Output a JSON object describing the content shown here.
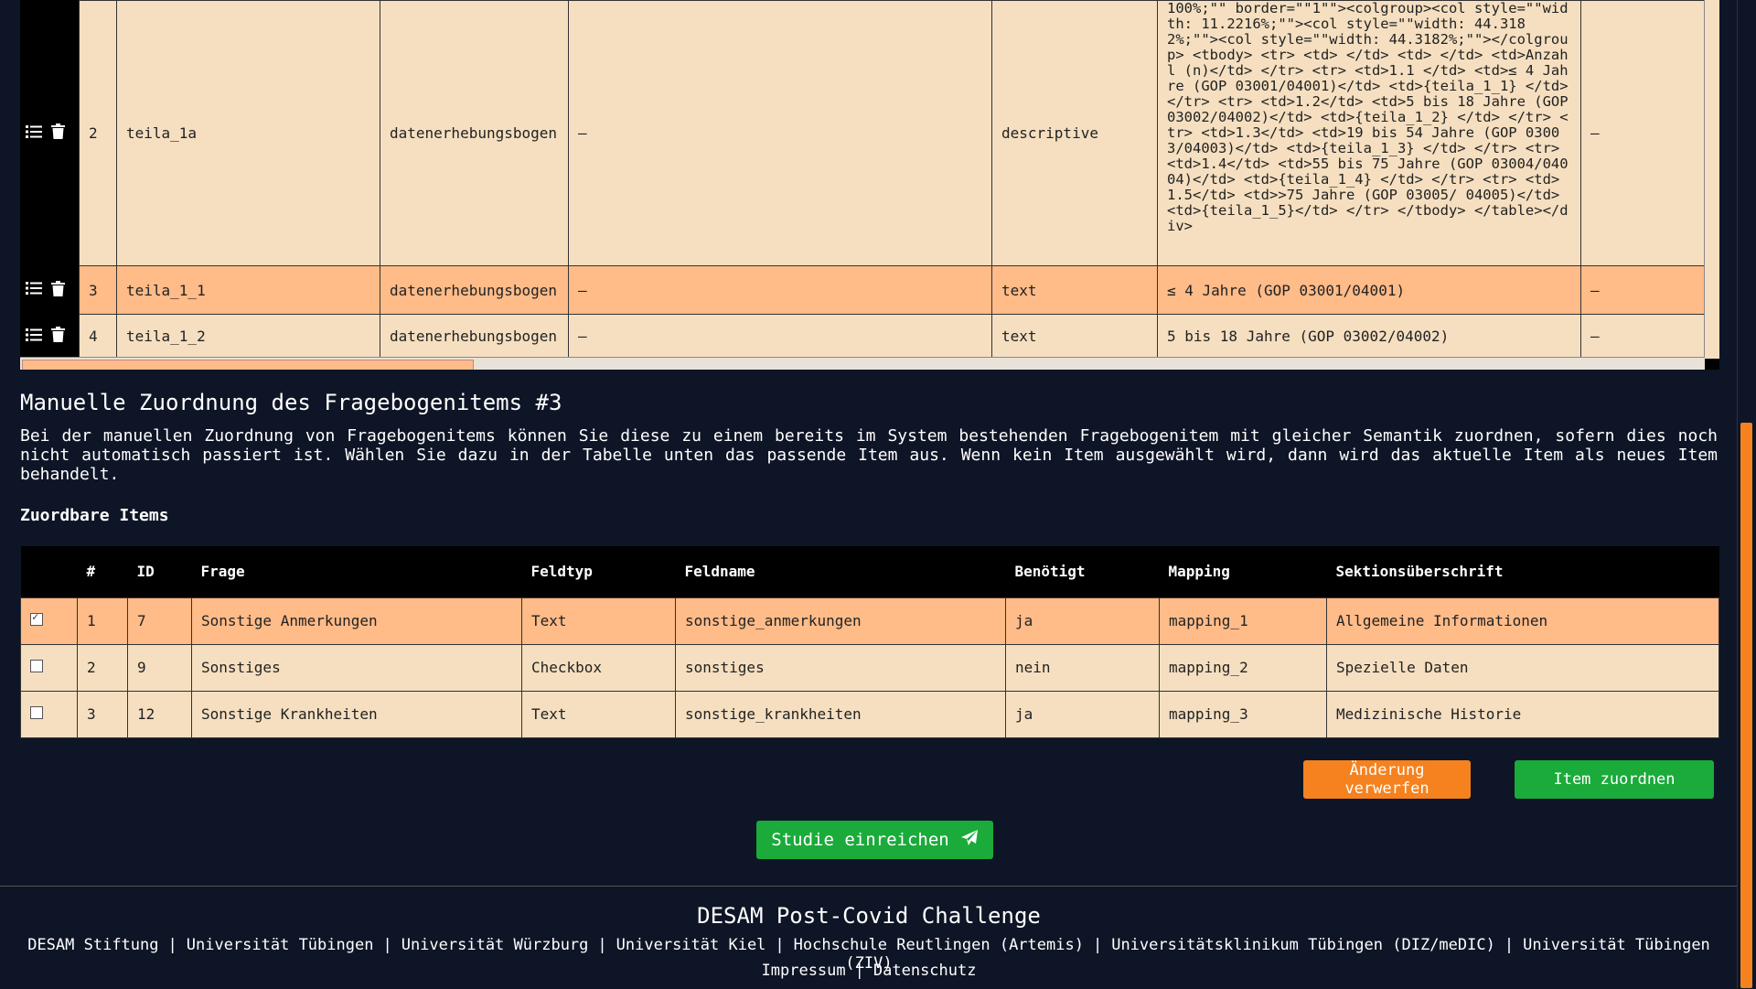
{
  "top_table": {
    "rows": [
      {
        "num": "2",
        "id": "teila_1a",
        "form": "datenerhebungsbogen",
        "dash1": "–",
        "type": "descriptive",
        "content": "100%;\"\" border=\"\"1\"\"><colgroup><col style=\"\"width: 11.2216%;\"\"><col style=\"\"width: 44.3182%;\"\"><col style=\"\"width: 44.3182%;\"\"></colgroup> <tbody> <tr> <td> </td> <td> </td> <td>Anzahl (n)</td> </tr> <tr> <td>1.1 </td> <td>≤ 4 Jahre (GOP 03001/04001)</td> <td>{teila_1_1} </td> </tr> <tr> <td>1.2</td> <td>5 bis 18 Jahre (GOP 03002/04002)</td> <td>{teila_1_2} </td> </tr> <tr> <td>1.3</td> <td>19 bis 54 Jahre (GOP 03003/04003)</td> <td>{teila_1_3} </td> </tr> <tr> <td>1.4</td> <td>55 bis 75 Jahre (GOP 03004/04004)</td> <td>{teila_1_4} </td> </tr> <tr> <td>1.5</td> <td>>75 Jahre (GOP 03005/ 04005)</td> <td>{teila_1_5}</td> </tr> </tbody> </table></div>",
        "dash2": "–"
      },
      {
        "num": "3",
        "id": "teila_1_1",
        "form": "datenerhebungsbogen",
        "dash1": "–",
        "type": "text",
        "content": "≤ 4 Jahre (GOP 03001/04001)",
        "dash2": "–"
      },
      {
        "num": "4",
        "id": "teila_1_2",
        "form": "datenerhebungsbogen",
        "dash1": "–",
        "type": "text",
        "content": "5 bis 18 Jahre (GOP 03002/04002)",
        "dash2": "–"
      }
    ]
  },
  "section": {
    "title": "Manuelle Zuordnung des Fragebogenitems #3",
    "description": "Bei der manuellen Zuordnung von Fragebogenitems können Sie diese zu einem bereits im System bestehenden Fragebogenitem mit gleicher Semantik zuordnen, sofern dies noch nicht automatisch passiert ist. Wählen Sie dazu in der Tabelle unten das passende Item aus. Wenn kein Item ausgewählt wird, dann wird das aktuelle Item als neues Item behandelt.",
    "subtitle": "Zuordbare Items"
  },
  "items_table": {
    "headers": [
      "#",
      "ID",
      "Frage",
      "Feldtyp",
      "Feldname",
      "Benötigt",
      "Mapping",
      "Sektionsüberschrift"
    ],
    "rows": [
      {
        "checked": true,
        "num": "1",
        "id": "7",
        "frage": "Sonstige Anmerkungen",
        "feldtyp": "Text",
        "feldname": "sonstige_anmerkungen",
        "benoetigt": "ja",
        "mapping": "mapping_1",
        "sektion": "Allgemeine Informationen"
      },
      {
        "checked": false,
        "num": "2",
        "id": "9",
        "frage": "Sonstiges",
        "feldtyp": "Checkbox",
        "feldname": "sonstiges",
        "benoetigt": "nein",
        "mapping": "mapping_2",
        "sektion": "Spezielle Daten"
      },
      {
        "checked": false,
        "num": "3",
        "id": "12",
        "frage": "Sonstige Krankheiten",
        "feldtyp": "Text",
        "feldname": "sonstige_krankheiten",
        "benoetigt": "ja",
        "mapping": "mapping_3",
        "sektion": "Medizinische Historie"
      }
    ]
  },
  "buttons": {
    "discard": "Änderung verwerfen",
    "assign": "Item zuordnen",
    "submit": "Studie einreichen"
  },
  "footer": {
    "title": "DESAM Post-Covid Challenge",
    "links": [
      "DESAM Stiftung",
      "Universität Tübingen",
      "Universität Würzburg",
      "Universität Kiel",
      "Hochschule Reutlingen (Artemis)",
      "Universitätsklinikum Tübingen (DIZ/meDIC)",
      "Universität Tübingen (ZIV)"
    ],
    "links2": [
      "Impressum",
      "Datenschutz"
    ]
  },
  "colors": {
    "accent_orange": "#f5821f",
    "accent_green": "#1aab3a",
    "row_light": "#f5dfc0",
    "row_selected": "#ffbb88",
    "background": "#0d1526"
  }
}
